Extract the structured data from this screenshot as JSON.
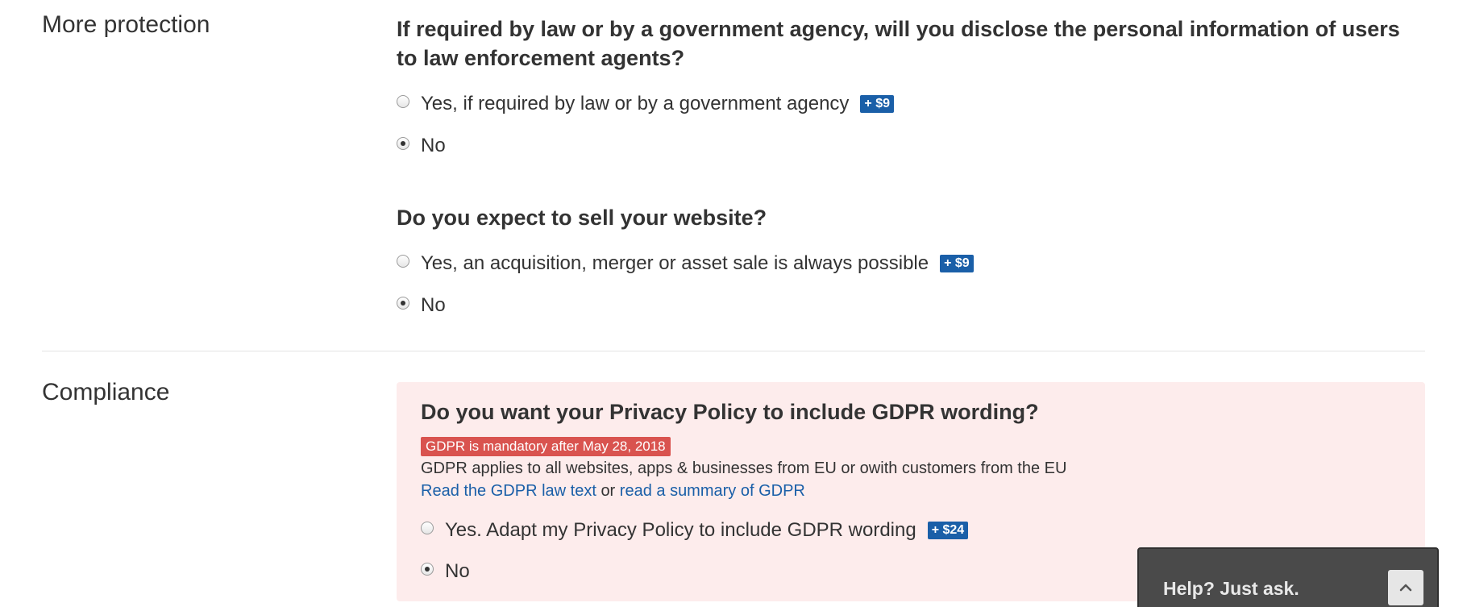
{
  "more_protection": {
    "label": "More protection",
    "q1": {
      "question": "If required by law or by a government agency, will you disclose the personal information of users to law enforcement agents?",
      "opt_yes": "Yes, if required by law or by a government agency",
      "opt_yes_price": "+ $9",
      "opt_no": "No",
      "selected": "No"
    },
    "q2": {
      "question": "Do you expect to sell your website?",
      "opt_yes": "Yes, an acquisition, merger or asset sale is always possible",
      "opt_yes_price": "+ $9",
      "opt_no": "No",
      "selected": "No"
    }
  },
  "compliance": {
    "label": "Compliance",
    "gdpr": {
      "question": "Do you want your Privacy Policy to include GDPR wording?",
      "badge": "GDPR is mandatory after May 28, 2018",
      "note": "GDPR applies to all websites, apps & businesses from EU or owith customers from the EU",
      "link_law": "Read the GDPR law text",
      "link_or": "or",
      "link_summary": "read a summary of GDPR",
      "opt_yes": "Yes. Adapt my Privacy Policy to include GDPR wording",
      "opt_yes_price": "+ $24",
      "opt_no": "No",
      "selected": "No"
    }
  },
  "help_widget": {
    "text": "Help? Just ask.",
    "icon": "chevron-up-icon"
  },
  "colors": {
    "price_badge": "#1a5fa8",
    "mandatory_badge": "#d9534f",
    "gdpr_box_bg": "#fdecec",
    "link": "#1a5fa8",
    "help_bg": "#4a4a4a"
  }
}
